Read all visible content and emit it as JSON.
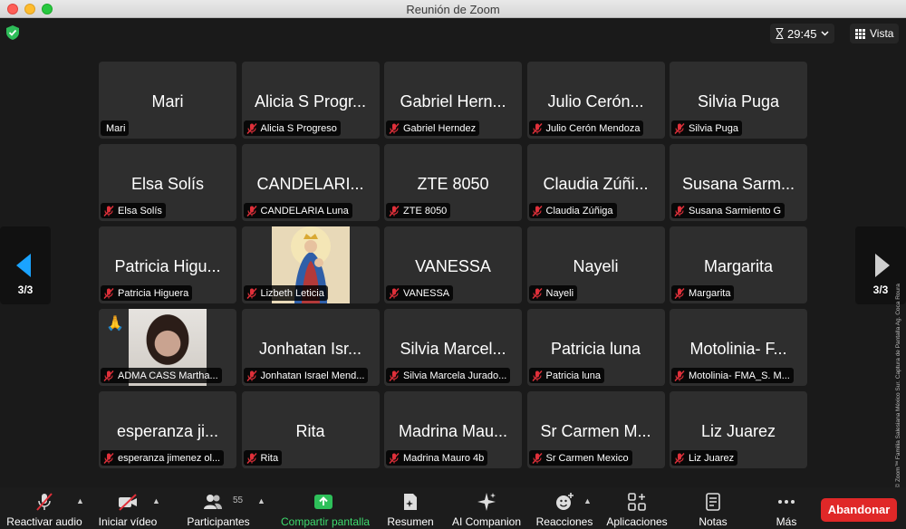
{
  "window": {
    "title": "Reunión de Zoom"
  },
  "topbar": {
    "timer": "29:45",
    "view_label": "Vista"
  },
  "page_indicator": {
    "left": "3/3",
    "right": "3/3"
  },
  "participants": [
    {
      "display": "Mari",
      "label": "Mari",
      "muted": false
    },
    {
      "display": "Alicia S Progr...",
      "label": "Alicia S Progreso",
      "muted": true
    },
    {
      "display": "Gabriel Hern...",
      "label": "Gabriel Herndez",
      "muted": true
    },
    {
      "display": "Julio Cerón...",
      "label": "Julio Cerón Mendoza",
      "muted": true
    },
    {
      "display": "Silvia Puga",
      "label": "Silvia Puga",
      "muted": true
    },
    {
      "display": "Elsa Solís",
      "label": "Elsa Solís",
      "muted": true
    },
    {
      "display": "CANDELARI...",
      "label": "CANDELARIA Luna",
      "muted": true
    },
    {
      "display": "ZTE 8050",
      "label": "ZTE 8050",
      "muted": true
    },
    {
      "display": "Claudia Zúñi...",
      "label": "Claudia Zúñiga",
      "muted": true
    },
    {
      "display": "Susana Sarm...",
      "label": "Susana Sarmiento G",
      "muted": true
    },
    {
      "display": "Patricia Higu...",
      "label": "Patricia Higuera",
      "muted": true
    },
    {
      "display": "",
      "label": "Lizbeth Leticia",
      "muted": true,
      "photo": "religious-image"
    },
    {
      "display": "VANESSA",
      "label": "VANESSA",
      "muted": true
    },
    {
      "display": "Nayeli",
      "label": "Nayeli",
      "muted": true
    },
    {
      "display": "Margarita",
      "label": "Margarita",
      "muted": true
    },
    {
      "display": "",
      "label": "ADMA CASS Martha...",
      "muted": true,
      "video": true,
      "reaction": "🙏"
    },
    {
      "display": "Jonhatan Isr...",
      "label": "Jonhatan Israel Mend...",
      "muted": true
    },
    {
      "display": "Silvia Marcel...",
      "label": "Silvia Marcela Jurado...",
      "muted": true
    },
    {
      "display": "Patricia luna",
      "label": "Patricia luna",
      "muted": true
    },
    {
      "display": "Motolinia- F...",
      "label": "Motolinia- FMA_S. M...",
      "muted": true
    },
    {
      "display": "esperanza ji...",
      "label": "esperanza jimenez ol...",
      "muted": true
    },
    {
      "display": "Rita",
      "label": "Rita",
      "muted": true
    },
    {
      "display": "Madrina Mau...",
      "label": "Madrina Mauro 4b",
      "muted": true
    },
    {
      "display": "Sr Carmen M...",
      "label": "Sr Carmen Mexico",
      "muted": true
    },
    {
      "display": "Liz Juarez",
      "label": "Liz Juarez",
      "muted": true
    }
  ],
  "credit": "Cortesía © Zoom™ Familia Salesiana México Sur. Captura de Pantalla Ag. Coca Roura",
  "toolbar": {
    "audio": "Reactivar audio",
    "video": "Iniciar vídeo",
    "participants": "Participantes",
    "participants_count": "55",
    "share": "Compartir pantalla",
    "summary": "Resumen",
    "ai": "AI Companion",
    "reactions": "Reacciones",
    "apps": "Aplicaciones",
    "notes": "Notas",
    "more": "Más",
    "leave": "Abandonar"
  },
  "colors": {
    "accent_blue": "#1aa3ff",
    "share_green": "#3ddc6e",
    "leave_red": "#e02828",
    "mute_red": "#e0303a"
  }
}
